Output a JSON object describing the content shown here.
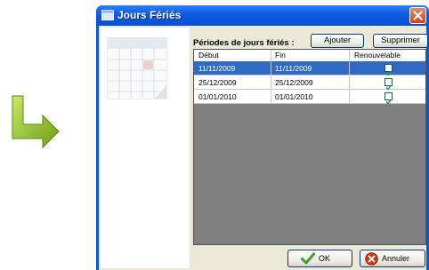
{
  "window": {
    "title": "Jours Fériés",
    "accent": "#0a56d8"
  },
  "panel": {
    "section_label": "Périodes de jours fériés :",
    "add_label": "Ajouter",
    "delete_label": "Supprimer"
  },
  "grid": {
    "columns": [
      "Début",
      "Fin",
      "Renouvelable"
    ],
    "rows": [
      {
        "start": "11/11/2009",
        "end": "11/11/2009",
        "renewable": true,
        "selected": true
      },
      {
        "start": "25/12/2009",
        "end": "25/12/2009",
        "renewable": true,
        "selected": false
      },
      {
        "start": "01/01/2010",
        "end": "01/01/2010",
        "renewable": true,
        "selected": false
      }
    ]
  },
  "footer": {
    "ok_label": "OK",
    "cancel_label": "Annuler"
  },
  "icons": [
    "arrow-icon",
    "window-icon",
    "close-icon",
    "calendar-icon",
    "checkmark-icon",
    "cancel-icon"
  ]
}
